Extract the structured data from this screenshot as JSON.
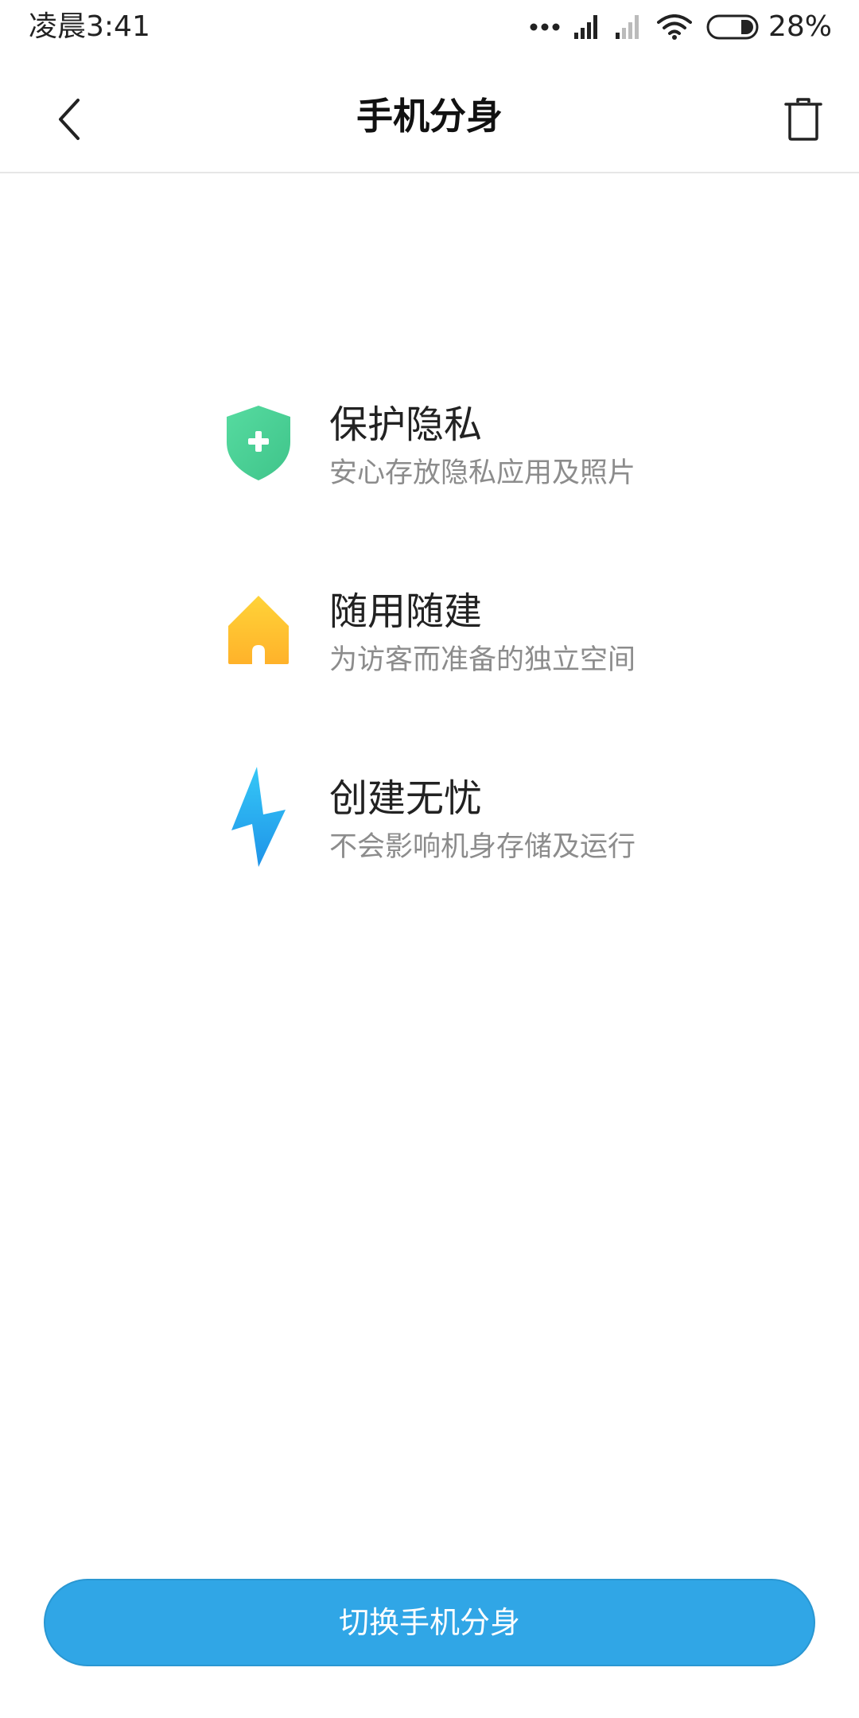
{
  "status_bar": {
    "time": "凌晨3:41",
    "battery_percent": "28%",
    "battery_level": 0.28,
    "icons": [
      "more-dots-icon",
      "signal-icon",
      "signal-weak-icon",
      "wifi-icon",
      "battery-icon"
    ]
  },
  "header": {
    "title": "手机分身",
    "back_icon": "chevron-left-icon",
    "delete_icon": "trash-icon"
  },
  "features": [
    {
      "title": "保护隐私",
      "description": "安心存放隐私应用及照片",
      "icon": "shield-plus-icon",
      "color": "#4fd39a"
    },
    {
      "title": "随用随建",
      "description": "为访客而准备的独立空间",
      "icon": "house-icon",
      "color": "#ffbf2a"
    },
    {
      "title": "创建无忧",
      "description": "不会影响机身存储及运行",
      "icon": "lightning-icon",
      "color": "#2aa9f0"
    }
  ],
  "footer": {
    "switch_button_label": "切换手机分身",
    "button_color": "#30a6e6"
  }
}
